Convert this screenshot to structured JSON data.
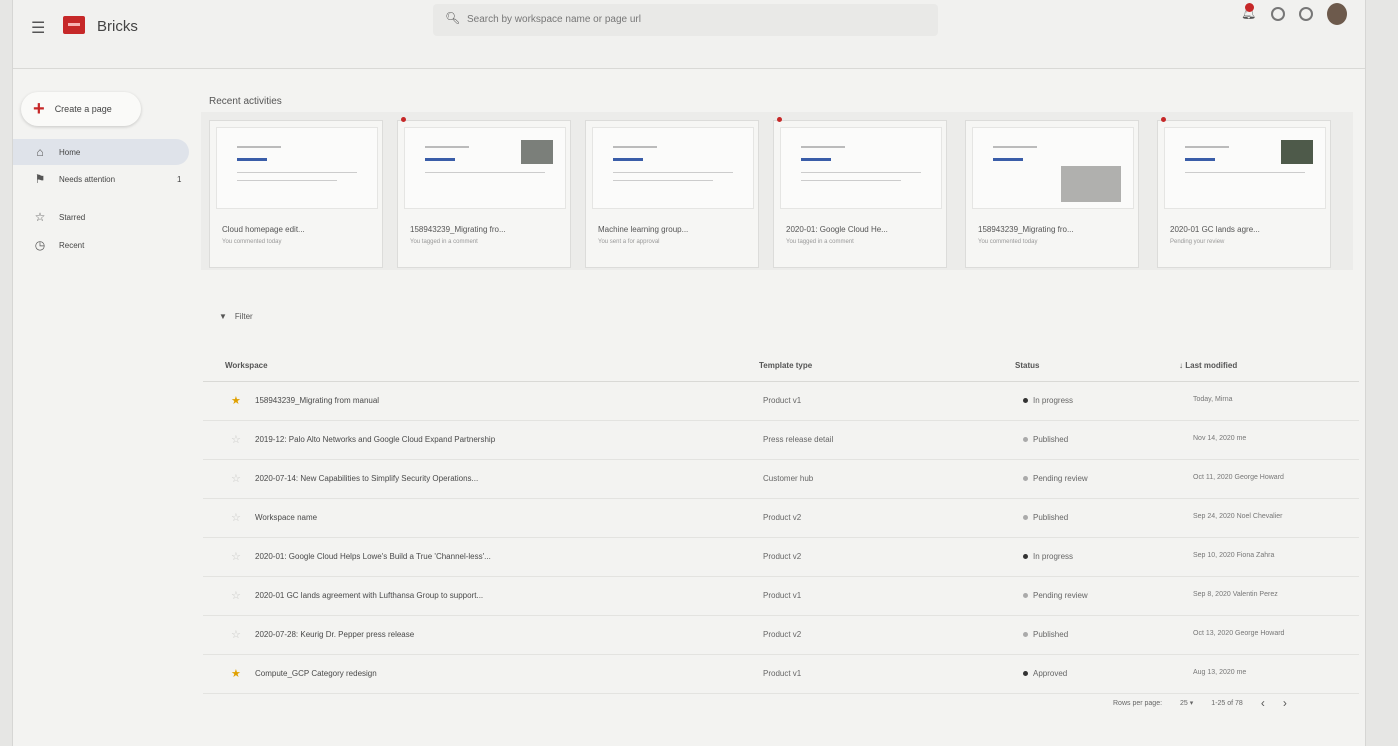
{
  "header": {
    "app_title": "Bricks",
    "search_placeholder": "Search by workspace name or page url"
  },
  "sidebar": {
    "create_label": "Create a page",
    "items": [
      {
        "label": "Home",
        "icon": "home-icon",
        "active": true
      },
      {
        "label": "Needs attention",
        "icon": "flag-icon",
        "count": "1"
      },
      {
        "label": "Starred",
        "icon": "star-icon"
      },
      {
        "label": "Recent",
        "icon": "clock-icon"
      }
    ]
  },
  "recent": {
    "title": "Recent activities",
    "cards": [
      {
        "title": "Cloud homepage edit...",
        "sub": "You commented today"
      },
      {
        "title": "158943239_Migrating fro...",
        "sub": "You tagged in a comment"
      },
      {
        "title": "Machine learning group...",
        "sub": "You sent a for approval"
      },
      {
        "title": "2020-01: Google Cloud He...",
        "sub": "You tagged in a comment"
      },
      {
        "title": "158943239_Migrating fro...",
        "sub": "You commented today"
      },
      {
        "title": "2020-01 GC lands agre...",
        "sub": "Pending your review"
      }
    ]
  },
  "filter_label": "Filter",
  "table": {
    "headers": {
      "workspace": "Workspace",
      "template": "Template type",
      "status": "Status",
      "modified": "Last modified"
    },
    "rows": [
      {
        "starred": true,
        "workspace": "158943239_Migrating from manual",
        "template": "Product v1",
        "status": "In progress",
        "modified": "Today, Mirna"
      },
      {
        "starred": false,
        "workspace": "2019-12: Palo Alto Networks and Google Cloud Expand Partnership",
        "template": "Press release detail",
        "status": "Published",
        "modified": "Nov 14, 2020 me"
      },
      {
        "starred": false,
        "workspace": "2020-07-14: New Capabilities to Simplify Security Operations...",
        "template": "Customer hub",
        "status": "Pending review",
        "modified": "Oct 11, 2020 George Howard"
      },
      {
        "starred": false,
        "workspace": "Workspace name",
        "template": "Product v2",
        "status": "Published",
        "modified": "Sep 24, 2020 Noel Chevalier"
      },
      {
        "starred": false,
        "workspace": "2020-01: Google Cloud Helps Lowe's Build a True 'Channel-less'...",
        "template": "Product v2",
        "status": "In progress",
        "modified": "Sep 10, 2020 Fiona Zahra"
      },
      {
        "starred": false,
        "workspace": "2020-01 GC lands agreement with Lufthansa Group to support...",
        "template": "Product v1",
        "status": "Pending review",
        "modified": "Sep 8, 2020 Valentin Perez"
      },
      {
        "starred": false,
        "workspace": "2020-07-28: Keurig Dr. Pepper press release",
        "template": "Product v2",
        "status": "Published",
        "modified": "Oct 13, 2020 George Howard"
      },
      {
        "starred": true,
        "workspace": "Compute_GCP Category redesign",
        "template": "Product v1",
        "status": "Approved",
        "modified": "Aug 13, 2020 me"
      }
    ]
  },
  "pager": {
    "rows_label": "Rows per page:",
    "rows_value": "25",
    "range": "1-25 of 78"
  }
}
